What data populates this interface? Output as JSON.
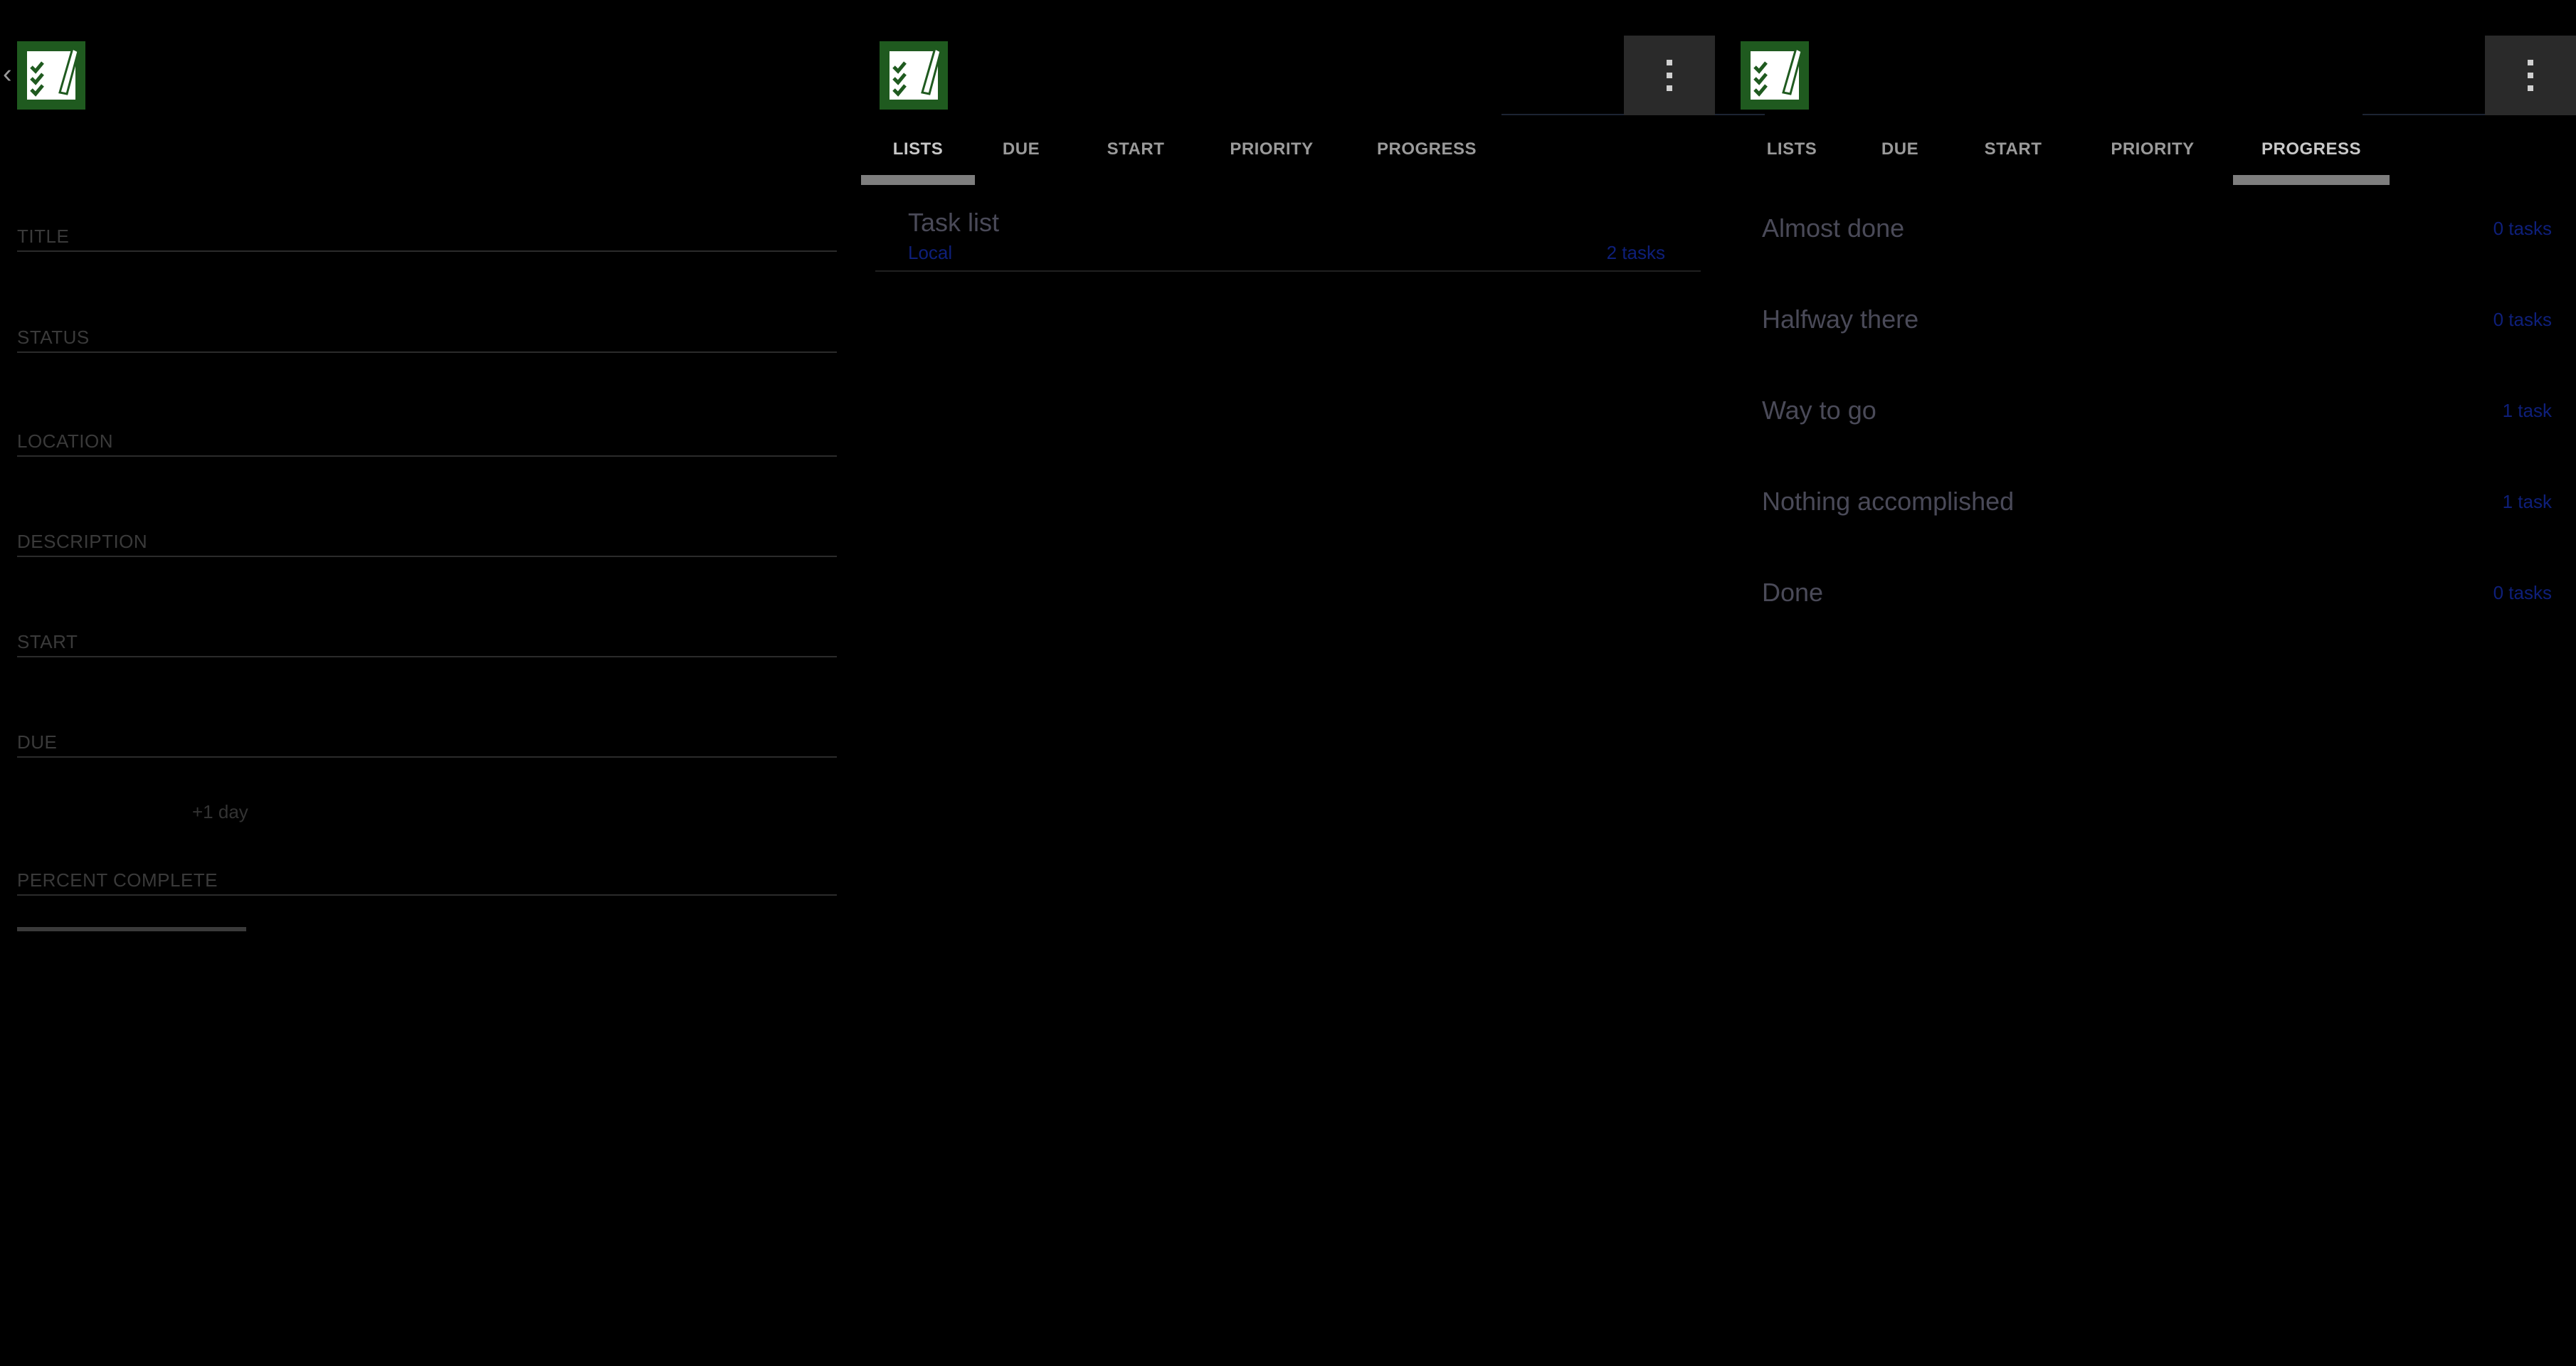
{
  "editor": {
    "fields": [
      {
        "label": "TITLE"
      },
      {
        "label": "STATUS"
      },
      {
        "label": "LOCATION"
      },
      {
        "label": "DESCRIPTION"
      },
      {
        "label": "START"
      },
      {
        "label": "DUE"
      },
      {
        "label": "PERCENT COMPLETE"
      }
    ],
    "due_offset": "+1 day",
    "percent_complete": 0
  },
  "tabs": [
    "LISTS",
    "DUE",
    "START",
    "PRIORITY",
    "PROGRESS"
  ],
  "lists_view": {
    "selected_tab": "LISTS",
    "items": [
      {
        "title": "Task list",
        "account": "Local",
        "count": "2 tasks"
      }
    ]
  },
  "progress_view": {
    "selected_tab": "PROGRESS",
    "items": [
      {
        "title": "Almost done",
        "count": "0 tasks"
      },
      {
        "title": "Halfway there",
        "count": "0 tasks"
      },
      {
        "title": "Way to go",
        "count": "1 task"
      },
      {
        "title": "Nothing accomplished",
        "count": "1 task"
      },
      {
        "title": "Done",
        "count": "0 tasks"
      }
    ]
  },
  "icons": {
    "app": "app-checklist-icon",
    "back": "back-chevron-icon",
    "overflow": "overflow-menu-icon"
  },
  "colors": {
    "background": "#000000",
    "icon_green": "#1f5a1f",
    "link_blue": "#0e1f7a",
    "tab_indicator": "#7e7e7e"
  }
}
